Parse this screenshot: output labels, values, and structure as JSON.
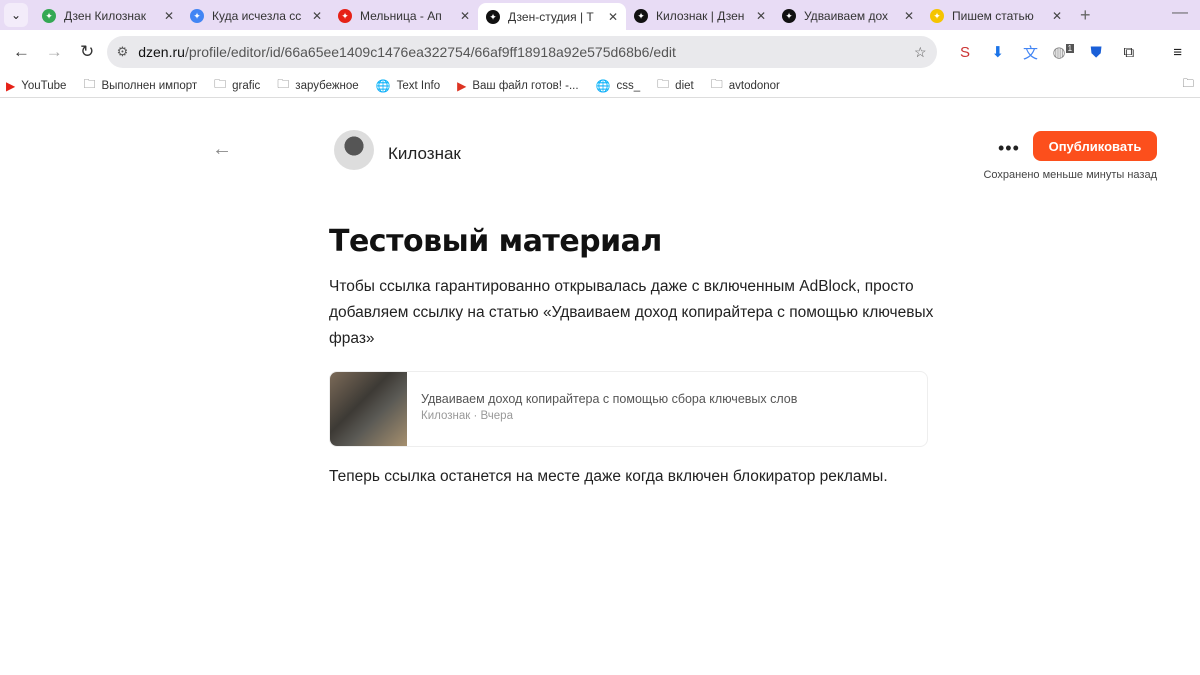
{
  "browser": {
    "tabs": [
      {
        "title": "Дзен Килознак",
        "icon": "google-drive-icon",
        "color": "#34a853"
      },
      {
        "title": "Куда исчезла сс",
        "icon": "google-docs-icon",
        "color": "#4285f4"
      },
      {
        "title": "Мельница - Ап",
        "icon": "youtube-icon",
        "color": "#e62117"
      },
      {
        "title": "Дзен-студия | Т",
        "icon": "dzen-icon",
        "color": "#111111",
        "active": true
      },
      {
        "title": "Килознак | Дзен",
        "icon": "dzen-icon",
        "color": "#111111"
      },
      {
        "title": "Удваиваем дох",
        "icon": "dzen-icon",
        "color": "#111111"
      },
      {
        "title": "Пишем статью",
        "icon": "play-icon",
        "color": "#f5c400"
      }
    ],
    "url_domain": "dzen.ru",
    "url_path": "/profile/editor/id/66a65ee1409c1476ea322754/66af9ff18918a92e575d68b6/edit",
    "bookmarks": [
      {
        "label": "YouTube",
        "icon": "youtube-icon"
      },
      {
        "label": "Выполнен импорт",
        "icon": "folder-icon"
      },
      {
        "label": "grafic",
        "icon": "folder-icon"
      },
      {
        "label": "зарубежное",
        "icon": "folder-icon"
      },
      {
        "label": "Text Info",
        "icon": "globe-icon"
      },
      {
        "label": "Ваш файл готов! -...",
        "icon": "video-icon"
      },
      {
        "label": "css_",
        "icon": "globe-icon"
      },
      {
        "label": "diet",
        "icon": "folder-icon"
      },
      {
        "label": "avtodonor",
        "icon": "folder-icon"
      }
    ],
    "extension_badge": "1"
  },
  "editor": {
    "channel": "Килознак",
    "publish_label": "Опубликовать",
    "saved_status": "Сохранено меньше минуты назад",
    "title": "Тестовый материал",
    "paragraph1": "Чтобы ссылка гарантированно открывалась даже с включенным AdBlock, просто добавляем ссылку на статью «Удваиваем доход копирайтера с помощью ключевых фраз»",
    "card": {
      "title": "Удваиваем доход копирайтера с помощью сбора ключевых слов",
      "meta": "Килознак · Вчера"
    },
    "paragraph2": "Теперь ссылка останется на месте даже когда включен блокиратор рекламы.",
    "accent": "#fc4f1c"
  }
}
